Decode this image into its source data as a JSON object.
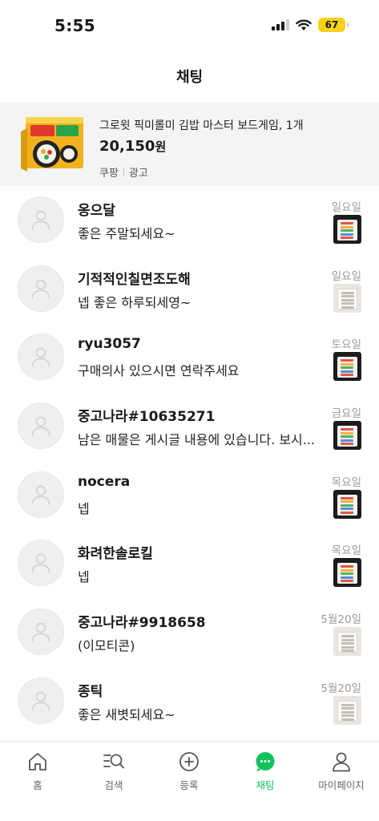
{
  "status_bar": {
    "time": "5:55",
    "battery": "67",
    "icons": [
      "signal-icon",
      "wifi-icon",
      "battery-icon"
    ],
    "battery_color": "#f8d21a"
  },
  "header": {
    "title": "채팅"
  },
  "ad": {
    "title": "그로윗 픽미롤미 김밥 마스터 보드게임, 1개",
    "price": "20,150",
    "currency": "원",
    "seller": "쿠팡",
    "label": "광고",
    "background": "#f2f4f6"
  },
  "chats": [
    {
      "name": "옹으달",
      "message": "좋은 주말되세요~",
      "date": "일요일",
      "thumb": "dark"
    },
    {
      "name": "기적적인칠면조도해",
      "message": "넵 좋은 하루되세영~",
      "date": "일요일",
      "thumb": "light"
    },
    {
      "name": "ryu3057",
      "message": "구매의사 있으시면 연락주세요",
      "date": "토요일",
      "thumb": "dark"
    },
    {
      "name": "중고나라#10635271",
      "message": "남은 매물은 게시글 내용에 있습니다. 보시...",
      "date": "금요일",
      "thumb": "dark"
    },
    {
      "name": "nocera",
      "message": "넵",
      "date": "목요일",
      "thumb": "dark"
    },
    {
      "name": "화려한솔로킬",
      "message": "넵",
      "date": "목요일",
      "thumb": "dark"
    },
    {
      "name": "중고나라#9918658",
      "message": "(이모티콘)",
      "date": "5월20일",
      "thumb": "light"
    },
    {
      "name": "종틱",
      "message": "좋은 새볏되세요~",
      "date": "5월20일",
      "thumb": "light"
    }
  ],
  "tabs": [
    {
      "label": "홈",
      "icon": "home-icon"
    },
    {
      "label": "검색",
      "icon": "search-icon"
    },
    {
      "label": "등록",
      "icon": "add-icon"
    },
    {
      "label": "채팅",
      "icon": "chat-icon",
      "active": true
    },
    {
      "label": "마이페이지",
      "icon": "person-icon"
    }
  ],
  "accent_color": "#11c25a"
}
